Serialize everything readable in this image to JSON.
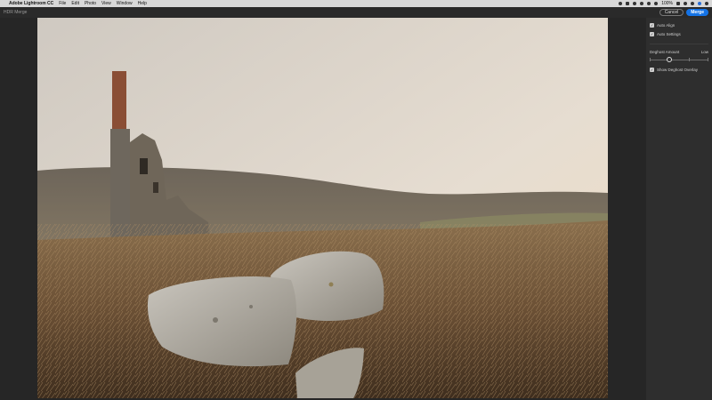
{
  "menubar": {
    "app_name": "Adobe Lightroom CC",
    "items": [
      "File",
      "Edit",
      "Photo",
      "View",
      "Window",
      "Help"
    ],
    "battery": "100%"
  },
  "header": {
    "title": "HDR Merge",
    "cancel_label": "Cancel",
    "merge_label": "Merge"
  },
  "panel": {
    "auto_align_label": "Auto Align",
    "auto_settings_label": "Auto Settings",
    "deghost_amount_label": "Deghost Amount",
    "deghost_value": "Low",
    "deghost_level_fraction": 0.33,
    "show_overlay_label": "Show Deghost Overlay"
  },
  "colors": {
    "accent": "#1473e6",
    "background": "#262626",
    "panel": "#2e2e2e"
  }
}
